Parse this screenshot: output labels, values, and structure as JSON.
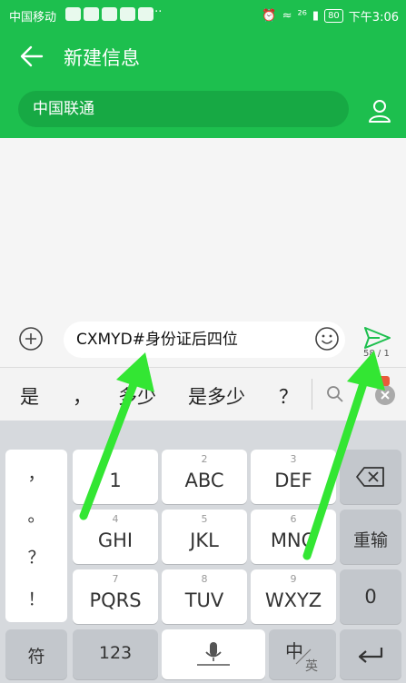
{
  "status_bar": {
    "carrier": "中国移动",
    "more": "···",
    "network": "²⁶",
    "battery": "80",
    "time": "下午3:06"
  },
  "header": {
    "back_icon": "arrow-left-icon",
    "title": "新建信息"
  },
  "recipient": {
    "value": "中国联通",
    "contact_icon": "person-icon"
  },
  "compose": {
    "text": "CXMYD#身份证后四位",
    "counter": "58 / 1",
    "add_icon": "plus-circle-icon",
    "emoji_icon": "smiley-icon",
    "send_icon": "send-icon"
  },
  "suggestions": {
    "items": [
      "是",
      "，",
      "多少",
      "是多少",
      "？"
    ],
    "search_icon": "search-icon",
    "close_icon": "close-icon"
  },
  "keyboard": {
    "punctuation": [
      "，",
      "。",
      "？",
      "！"
    ],
    "keys": [
      {
        "num": "",
        "label": "1"
      },
      {
        "num": "2",
        "label": "ABC"
      },
      {
        "num": "3",
        "label": "DEF"
      },
      {
        "num": "4",
        "label": "GHI"
      },
      {
        "num": "5",
        "label": "JKL"
      },
      {
        "num": "6",
        "label": "MNO"
      },
      {
        "num": "7",
        "label": "PQRS"
      },
      {
        "num": "8",
        "label": "TUV"
      },
      {
        "num": "9",
        "label": "WXYZ"
      }
    ],
    "reenter": "重输",
    "zero": "0",
    "symbol": "符",
    "num_switch": "123",
    "lang_main": "中",
    "lang_sub": "英",
    "delete_icon": "backspace-icon",
    "mic_icon": "microphone-icon",
    "enter_icon": "enter-icon"
  },
  "colors": {
    "brand_green": "#1dbf4e",
    "annotation_arrow": "#33e633"
  }
}
